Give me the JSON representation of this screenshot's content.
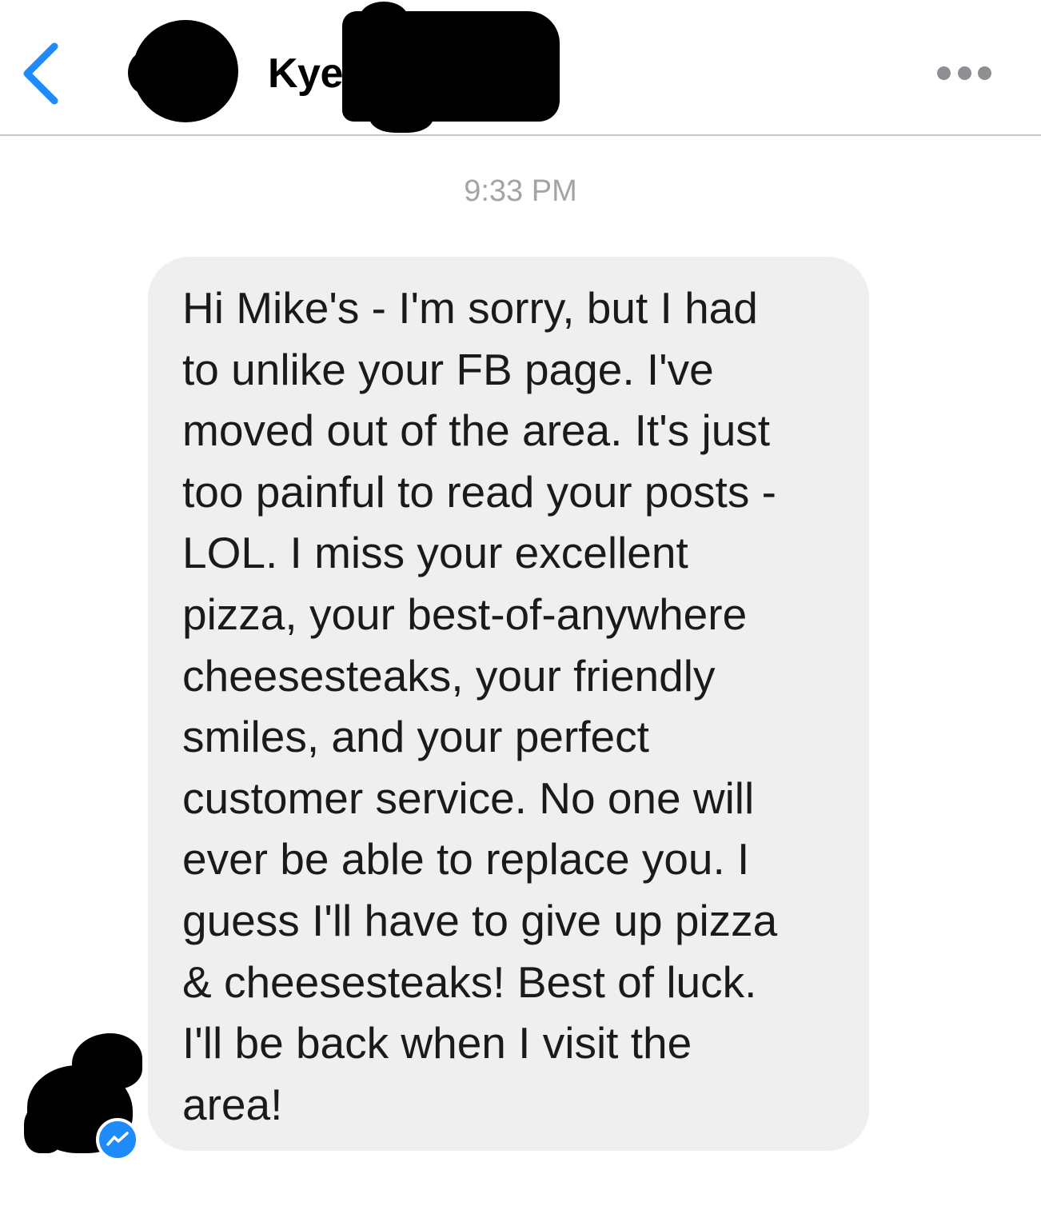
{
  "header": {
    "contact_name": "Kye"
  },
  "conversation": {
    "timestamp": "9:33 PM",
    "message": "Hi Mike's - I'm sorry, but I had\nto unlike your FB page. I've\nmoved out of the area. It's just\ntoo painful to read your posts -\nLOL. I miss your excellent\npizza, your best-of-anywhere\ncheesesteaks, your friendly\nsmiles, and your perfect\ncustomer service. No one will\never be able to replace you. I\nguess I'll have to give up pizza\n& cheesesteaks! Best of luck.\nI'll be back when I visit the\narea!"
  },
  "icons": {
    "back": "chevron-left-icon",
    "more": "more-horizontal-icon",
    "badge": "messenger-icon"
  },
  "colors": {
    "accent": "#1f8bfb",
    "bubble": "#efefef",
    "timestamp": "#a4a4a8",
    "more_dots": "#8e8e93"
  }
}
